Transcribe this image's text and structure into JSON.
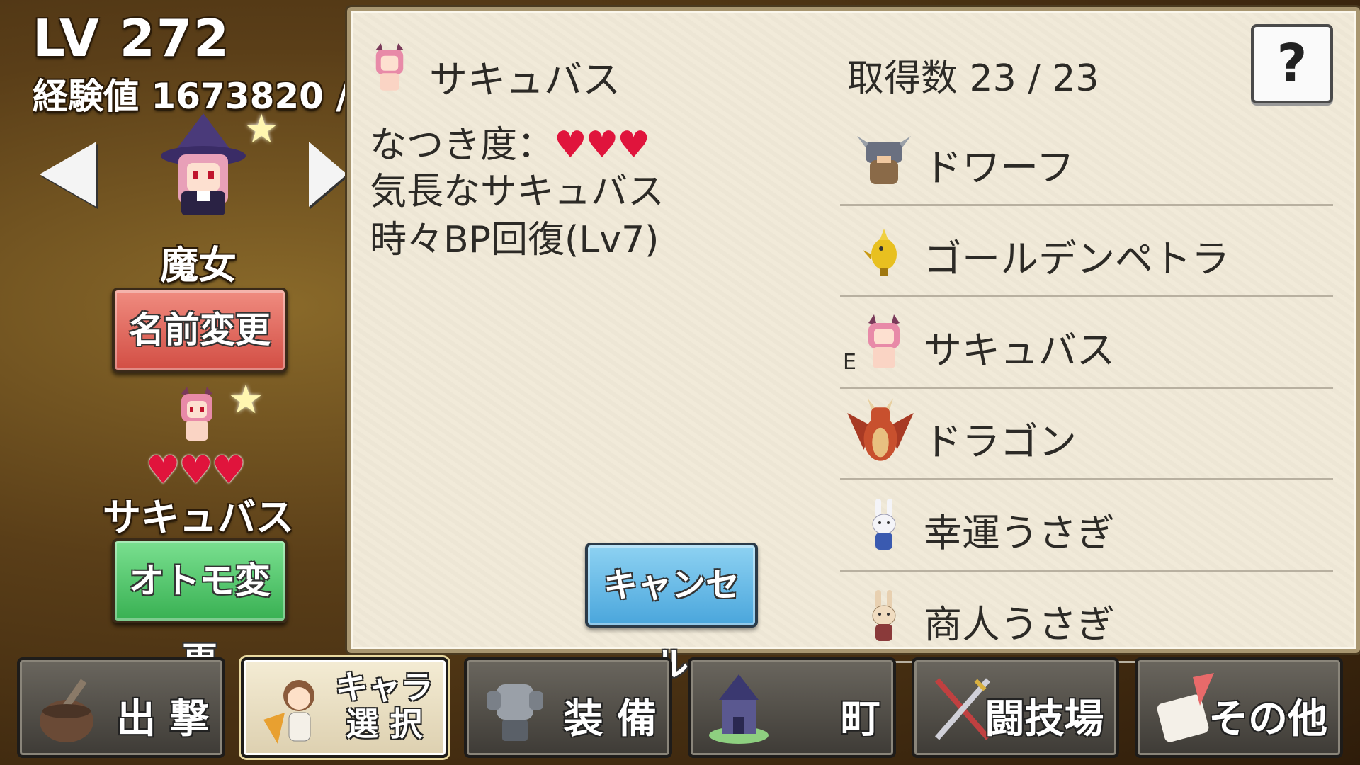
{
  "player": {
    "level": "LV 272",
    "exp": "経験値 1673820 /",
    "job": "魔女"
  },
  "buttons": {
    "rename": "名前変更",
    "change_partner": "オトモ変更",
    "cancel": "キャンセル",
    "help": "?"
  },
  "partner": {
    "name": "サキュバス",
    "hearts": "♥♥♥"
  },
  "detail": {
    "name": "サキュバス",
    "affection_label": "なつき度：",
    "affection_hearts": "♥♥♥",
    "description": "気長なサキュバス",
    "skill": "時々BP回復(Lv7)",
    "count": "取得数 23 / 23"
  },
  "pet_list": [
    {
      "name": "ドワーフ",
      "icon": "dwarf-icon",
      "equipped": ""
    },
    {
      "name": "ゴールデンペトラ",
      "icon": "golden-bird-icon",
      "equipped": ""
    },
    {
      "name": "サキュバス",
      "icon": "succubus-icon",
      "equipped": "E"
    },
    {
      "name": "ドラゴン",
      "icon": "dragon-icon",
      "equipped": ""
    },
    {
      "name": "幸運うさぎ",
      "icon": "lucky-rabbit-icon",
      "equipped": ""
    },
    {
      "name": "商人うさぎ",
      "icon": "merchant-rabbit-icon",
      "equipped": ""
    }
  ],
  "nav": {
    "sortie": "出 撃",
    "character_select_1": "キャラ",
    "character_select_2": "選 択",
    "equipment": "装 備",
    "town": "町",
    "arena": "闘技場",
    "other": "その他"
  },
  "colors": {
    "heart": "#e0143c",
    "rename_button": "#e06a60",
    "partner_button": "#4cc064",
    "cancel_button": "#5ab2e2",
    "parchment": "#f1ead8"
  }
}
